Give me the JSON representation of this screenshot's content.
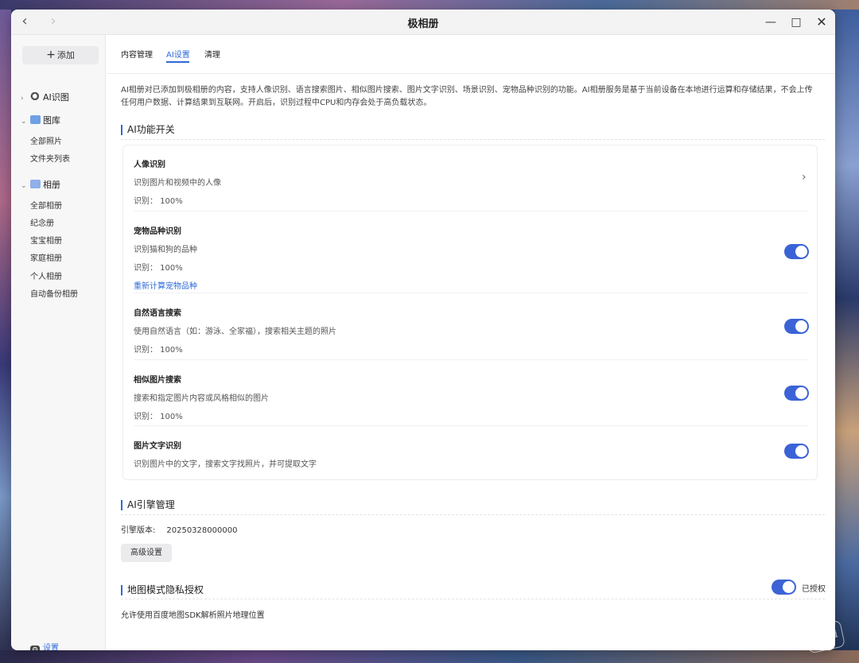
{
  "window": {
    "title": "极相册",
    "nav_back": "‹",
    "nav_forward": "›",
    "min": "—",
    "max": "□",
    "close": "✕"
  },
  "sidebar": {
    "add_label": "添加",
    "ai_group": "AI识图",
    "gallery_group": "图库",
    "gallery_items": [
      "全部照片",
      "文件夹列表"
    ],
    "album_group": "相册",
    "album_items": [
      "全部相册",
      "纪念册",
      "宝宝相册",
      "家庭相册",
      "个人相册",
      "自动备份相册"
    ],
    "settings_label": "设置"
  },
  "tabs": [
    "内容管理",
    "AI设置",
    "清理"
  ],
  "active_tab": "AI设置",
  "description": "AI相册对已添加到极相册的内容，支持人像识别、语言搜索图片、相似图片搜索、图片文字识别、场景识别、宠物品种识别的功能。AI相册服务是基于当前设备在本地进行运算和存储结果，不会上传任何用户数据、计算结果到互联网。开启后，识别过程中CPU和内存会处于高负载状态。",
  "ai_section": {
    "title": "AI功能开关",
    "features": [
      {
        "name": "人像识别",
        "desc": "识别图片和视频中的人像",
        "progress": "识别： 100%",
        "control": "chevron"
      },
      {
        "name": "宠物品种识别",
        "desc": "识别猫和狗的品种",
        "progress": "识别： 100%",
        "link": "重新计算宠物品种",
        "enabled": true
      },
      {
        "name": "自然语言搜索",
        "desc": "使用自然语言（如：游泳、全家福），搜索相关主题的照片",
        "progress": "识别： 100%",
        "enabled": true
      },
      {
        "name": "相似图片搜索",
        "desc": "搜索和指定图片内容或风格相似的图片",
        "progress": "识别： 100%",
        "enabled": true
      },
      {
        "name": "图片文字识别",
        "desc": "识别图片中的文字，搜索文字找照片，并可提取文字",
        "enabled": true
      }
    ]
  },
  "engine_section": {
    "title": "AI引擎管理",
    "version_label": "引擎版本:",
    "version_value": "20250328000000",
    "advanced_button": "高级设置"
  },
  "map_section": {
    "title": "地图模式隐私授权",
    "enabled": true,
    "status": "已授权",
    "desc": "允许使用百度地图SDK解析照片地理位置"
  },
  "watermark": "聚超值",
  "colors": {
    "accent": "#2f6ad8",
    "toggle_on": "#3b63d6"
  }
}
